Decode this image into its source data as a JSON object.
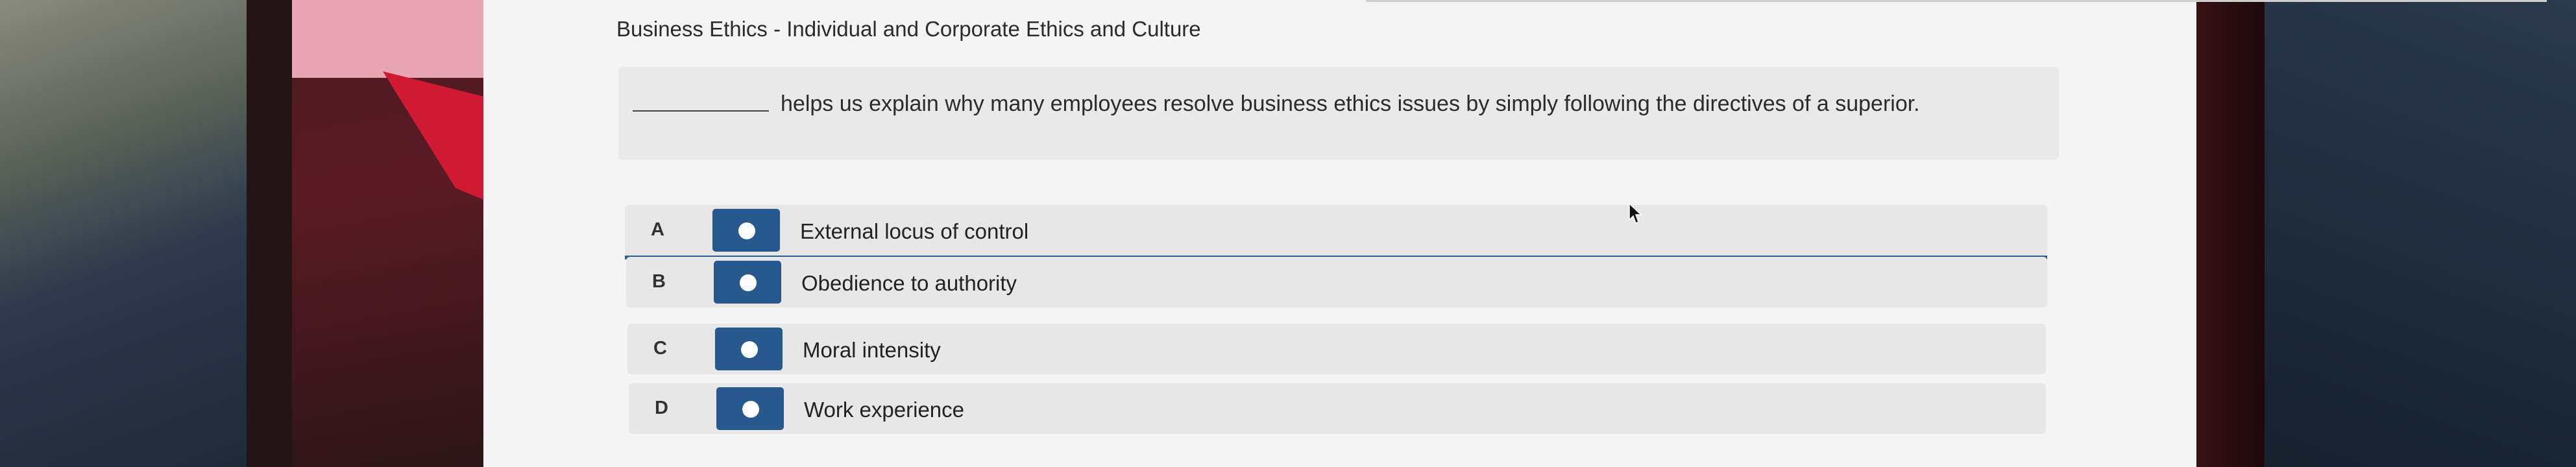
{
  "breadcrumb": "Business Ethics - Individual and Corporate Ethics and Culture",
  "question": {
    "blank": "",
    "text": "helps us explain why many employees resolve business ethics issues by simply following the directives of a superior."
  },
  "options": [
    {
      "letter": "A",
      "label": "External locus of control",
      "selected": true
    },
    {
      "letter": "B",
      "label": "Obedience to authority",
      "selected": false
    },
    {
      "letter": "C",
      "label": "Moral intensity",
      "selected": false
    },
    {
      "letter": "D",
      "label": "Work experience",
      "selected": false
    }
  ],
  "colors": {
    "accent": "#27588e",
    "page_background": "#f4f4f4",
    "card_background": "#e7e7e7"
  },
  "icons": {
    "cursor": "mouse-pointer-icon"
  }
}
